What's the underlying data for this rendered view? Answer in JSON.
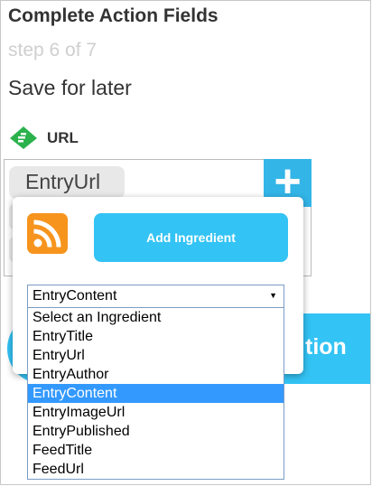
{
  "header": {
    "title": "Complete Action Fields",
    "step": "step 6 of 7",
    "save_link": "Save for later"
  },
  "field": {
    "label": "URL",
    "icon": "feedly-icon",
    "value_pill": "EntryUrl",
    "add_symbol": "+"
  },
  "popup": {
    "icon": "rss-icon",
    "add_button": "Add Ingredient",
    "select_value": "EntryContent",
    "options": [
      "Select an Ingredient",
      "EntryTitle",
      "EntryUrl",
      "EntryAuthor",
      "EntryContent",
      "EntryImageUrl",
      "EntryPublished",
      "FeedTitle",
      "FeedUrl"
    ],
    "selected_index": 4
  },
  "complete_button": {
    "visible_text": "tion"
  },
  "colors": {
    "accent": "#33c3f4",
    "selected": "#3399ff",
    "rss": "#f7941e",
    "feedly": "#2bb24c"
  }
}
